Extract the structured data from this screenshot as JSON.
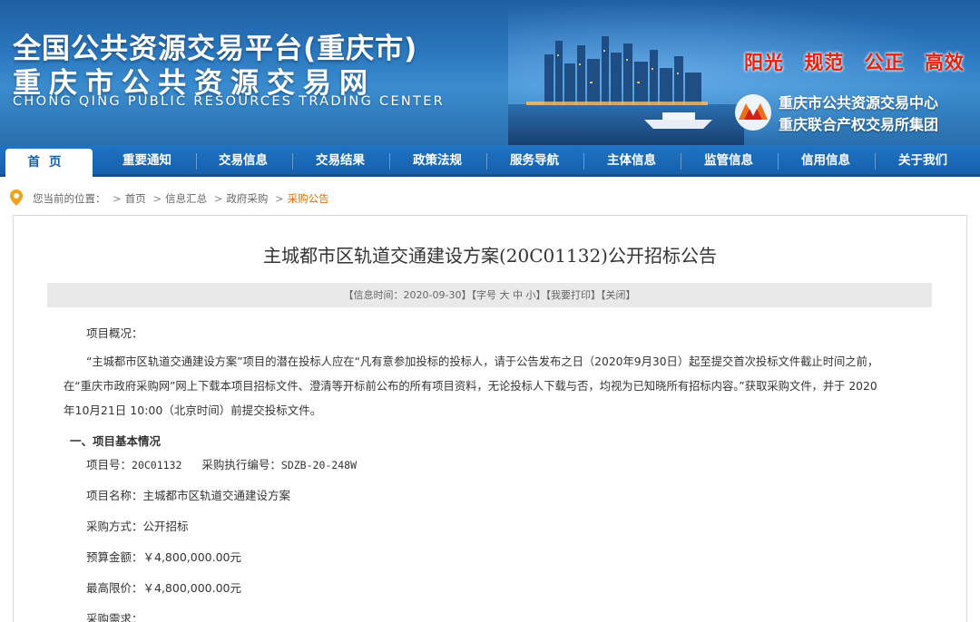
{
  "banner": {
    "title_main": "全国公共资源交易平台(重庆市)",
    "title_sub": "重庆市公共资源交易网",
    "title_en": "CHONG QING PUBLIC RESOURCES TRADING CENTER",
    "slogans": [
      "阳光",
      "规范",
      "公正",
      "高效"
    ],
    "org_line1": "重庆市公共资源交易中心",
    "org_line2": "重庆联合产权交易所集团"
  },
  "nav": {
    "items": [
      {
        "label": "首页"
      },
      {
        "label": "重要通知"
      },
      {
        "label": "交易信息"
      },
      {
        "label": "交易结果"
      },
      {
        "label": "政策法规"
      },
      {
        "label": "服务导航"
      },
      {
        "label": "主体信息"
      },
      {
        "label": "监管信息"
      },
      {
        "label": "信用信息"
      },
      {
        "label": "关于我们"
      }
    ]
  },
  "breadcrumb": {
    "prefix": "您当前的位置：",
    "items": [
      "首页",
      "信息汇总",
      "政府采购",
      "采购公告"
    ],
    "separator": ">"
  },
  "article": {
    "title": "主城都市区轨道交通建设方案(20C01132)公开招标公告",
    "info_time_label": "【信息时间：",
    "info_time_value": "2020-09-30",
    "info_time_close": "】",
    "font_label": "【字号",
    "font_large": "大",
    "font_medium": "中",
    "font_small": "小",
    "font_close": "】",
    "print_label": "【我要打印】",
    "close_label": "【关闭】",
    "overview_label": "项目概况：",
    "overview_line1": "“主城都市区轨道交通建设方案”项目的潜在投标人应在“凡有意参加投标的投标人，请于公告发布之日（2020年9月30日）起至提交首次投标文件截止时间之前，",
    "overview_line2": "在“重庆市政府采购网”网上下载本项目招标文件、澄清等开标前公布的所有项目资料，无论投标人下载与否，均视为已知晓所有招标内容。”获取采购文件，并于 2020",
    "overview_line3": "年10月21日 10:00（北京时间）前提交投标文件。",
    "section1_heading": "一、项目基本情况",
    "project_no_label": "项目号：",
    "project_no_value": "20C01132",
    "exec_no_label": "采购执行编号：",
    "exec_no_value": "SDZB-20-248W",
    "project_name": "项目名称：主城都市区轨道交通建设方案",
    "procurement_method": "采购方式：公开招标",
    "budget": "预算金额：￥4,800,000.00元",
    "max_price": "最高限价：￥4,800,000.00元",
    "demand_label": "采购需求："
  },
  "colors": {
    "nav_blue": "#1560ad",
    "slogan_red": "#e8200a",
    "current_crumb": "#e36c09"
  }
}
